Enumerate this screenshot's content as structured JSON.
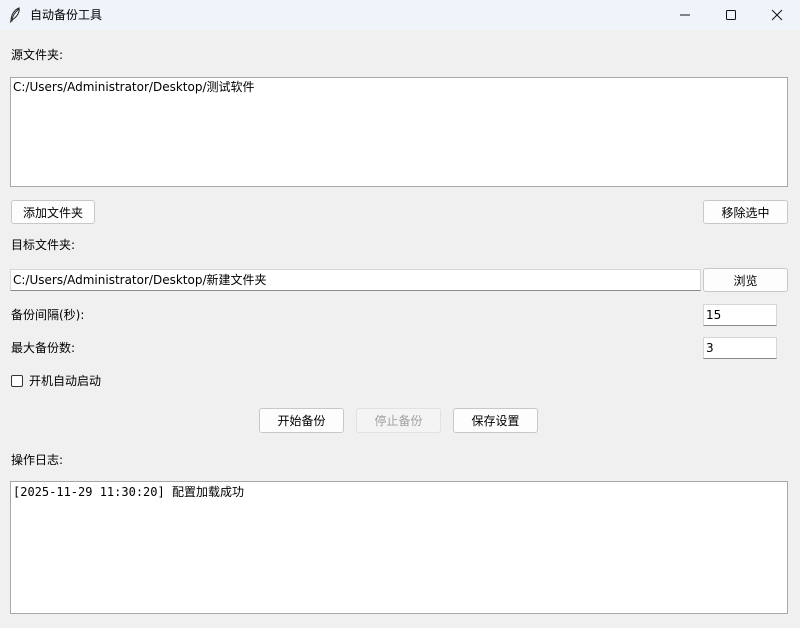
{
  "window": {
    "title": "自动备份工具",
    "icon": "feather-icon",
    "controls": {
      "minimize_icon": "minimize-icon",
      "maximize_icon": "maximize-icon",
      "close_icon": "close-icon"
    }
  },
  "source": {
    "label": "源文件夹:",
    "items": [
      "C:/Users/Administrator/Desktop/测试软件"
    ],
    "add_button": "添加文件夹",
    "remove_button": "移除选中"
  },
  "target": {
    "label": "目标文件夹:",
    "path": "C:/Users/Administrator/Desktop/新建文件夹",
    "browse_button": "浏览"
  },
  "settings": {
    "interval_label": "备份间隔(秒):",
    "interval_value": "15",
    "max_label": "最大备份数:",
    "max_value": "3",
    "autostart_label": "开机自动启动",
    "autostart_checked": false
  },
  "actions": {
    "start": "开始备份",
    "stop": "停止备份",
    "save": "保存设置"
  },
  "log": {
    "label": "操作日志:",
    "lines": [
      "[2025-11-29 11:30:20] 配置加载成功"
    ]
  },
  "colors": {
    "titlebar_bg": "#eef4f9",
    "window_bg": "#f0f0f0",
    "disabled_text": "#a0a0a0"
  }
}
